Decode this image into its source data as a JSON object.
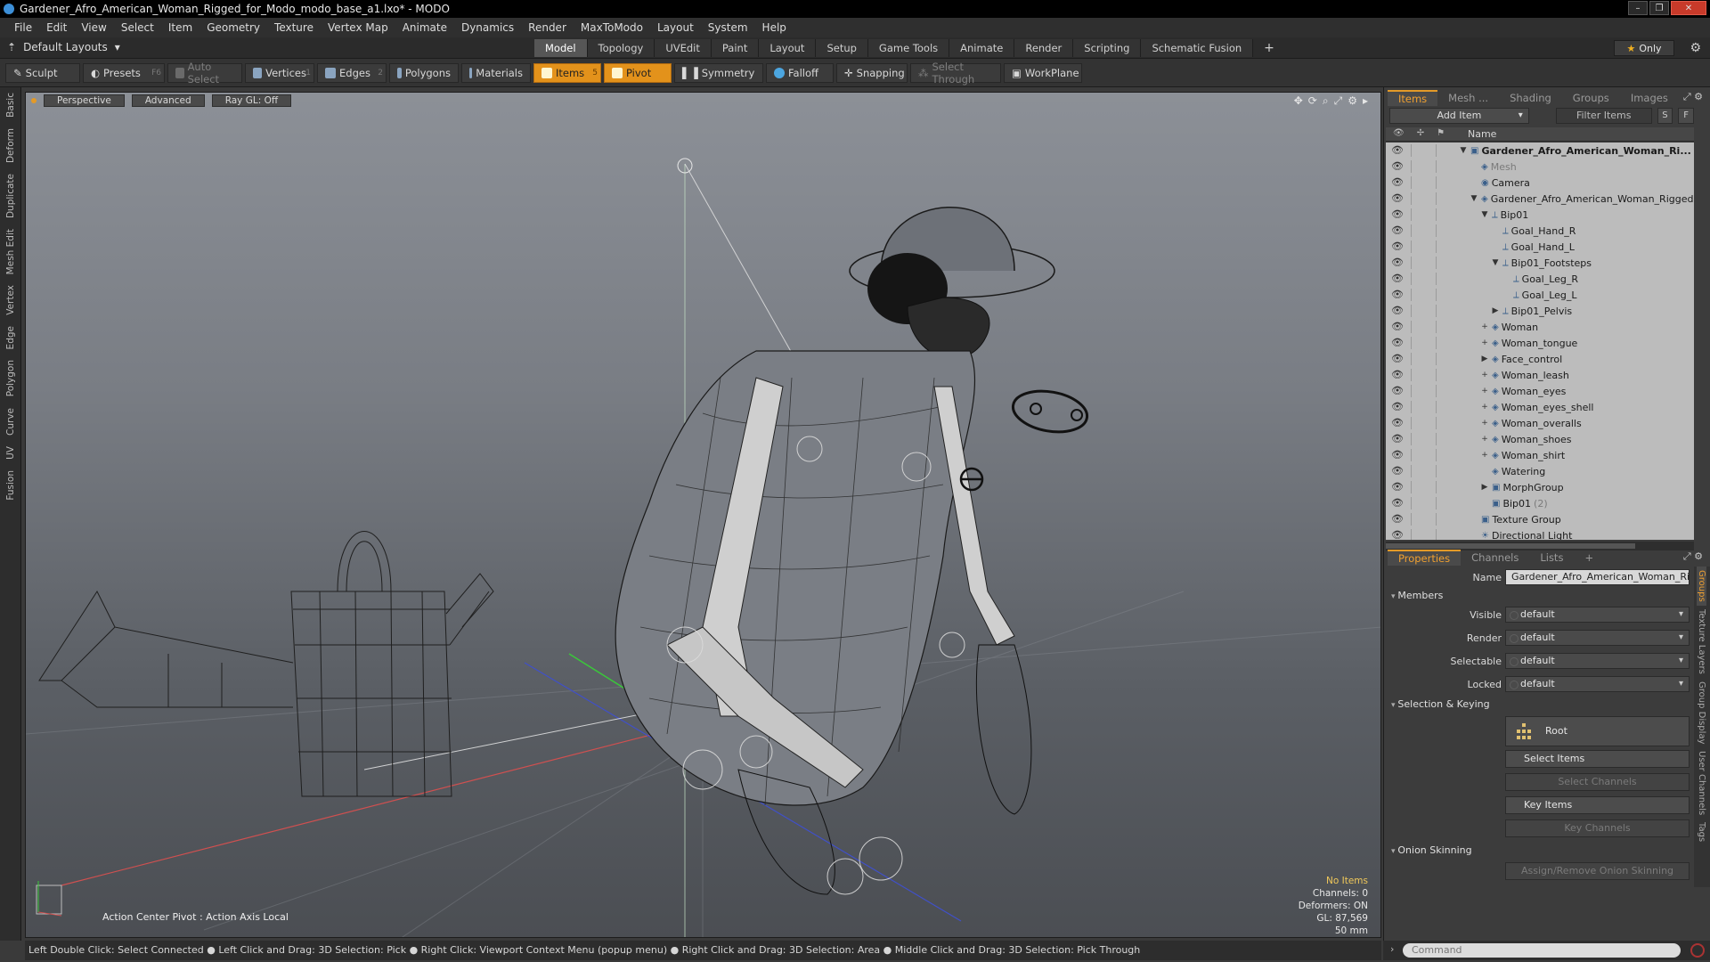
{
  "window": {
    "title": "Gardener_Afro_American_Woman_Rigged_for_Modo_modo_base_a1.lxo* - MODO",
    "minimize": "–",
    "maximize": "❐",
    "close": "✕"
  },
  "menu": [
    "File",
    "Edit",
    "View",
    "Select",
    "Item",
    "Geometry",
    "Texture",
    "Vertex Map",
    "Animate",
    "Dynamics",
    "Render",
    "MaxToModo",
    "Layout",
    "System",
    "Help"
  ],
  "layout": {
    "selector": "Default Layouts",
    "tabs": [
      "Model",
      "Topology",
      "UVEdit",
      "Paint",
      "Layout",
      "Setup",
      "Game Tools",
      "Animate",
      "Render",
      "Scripting",
      "Schematic Fusion"
    ],
    "active_tab": "Model",
    "add_tab": "+",
    "only_label": "Only"
  },
  "toolbar": {
    "sculpt": "Sculpt",
    "presets": "Presets",
    "presets_key": "F6",
    "auto_select": "Auto Select",
    "vertices": "Vertices",
    "vertices_key": "1",
    "edges": "Edges",
    "edges_key": "2",
    "polygons": "Polygons",
    "materials": "Materials",
    "items": "Items",
    "items_key": "5",
    "pivot": "Pivot",
    "symmetry": "Symmetry",
    "falloff": "Falloff",
    "snapping": "Snapping",
    "select_through": "Select Through",
    "workplane": "WorkPlane"
  },
  "left_tabs": [
    "Basic",
    "Deform",
    "Duplicate",
    "Mesh Edit",
    "Vertex",
    "Edge",
    "Polygon",
    "Curve",
    "UV",
    "Fusion"
  ],
  "viewport": {
    "view": "Perspective",
    "shading": "Advanced",
    "raygl": "Ray GL: Off",
    "action_center": "Action Center Pivot : Action Axis Local",
    "info": {
      "items": "No Items",
      "channels": "Channels: 0",
      "deformers": "Deformers: ON",
      "gl": "GL: 87,569",
      "focal": "50 mm"
    }
  },
  "items_panel": {
    "tabs": [
      "Items",
      "Mesh ...",
      "Shading",
      "Groups",
      "Images"
    ],
    "active_tab": "Items",
    "add_item": "Add Item",
    "filter": "Filter Items",
    "s_btn": "S",
    "f_btn": "F",
    "col_name": "Name",
    "rows": [
      {
        "label": "Gardener_Afro_American_Woman_Ri...",
        "indent": 0,
        "twisty": "▼",
        "icon": "group",
        "bold": true
      },
      {
        "label": "Mesh",
        "indent": 1,
        "twisty": "",
        "icon": "mesh",
        "dim": true
      },
      {
        "label": "Camera",
        "indent": 1,
        "twisty": "",
        "icon": "camera"
      },
      {
        "label": "Gardener_Afro_American_Woman_Rigged",
        "indent": 1,
        "twisty": "▼",
        "icon": "mesh"
      },
      {
        "label": "Bip01",
        "indent": 2,
        "twisty": "▼",
        "icon": "locator"
      },
      {
        "label": "Goal_Hand_R",
        "indent": 3,
        "twisty": "",
        "icon": "locator"
      },
      {
        "label": "Goal_Hand_L",
        "indent": 3,
        "twisty": "",
        "icon": "locator"
      },
      {
        "label": "Bip01_Footsteps",
        "indent": 3,
        "twisty": "▼",
        "icon": "locator"
      },
      {
        "label": "Goal_Leg_R",
        "indent": 4,
        "twisty": "",
        "icon": "locator"
      },
      {
        "label": "Goal_Leg_L",
        "indent": 4,
        "twisty": "",
        "icon": "locator"
      },
      {
        "label": "Bip01_Pelvis",
        "indent": 3,
        "twisty": "▶",
        "icon": "locator"
      },
      {
        "label": "Woman",
        "indent": 2,
        "twisty": "+",
        "icon": "mesh"
      },
      {
        "label": "Woman_tongue",
        "indent": 2,
        "twisty": "+",
        "icon": "mesh"
      },
      {
        "label": "Face_control",
        "indent": 2,
        "twisty": "▶",
        "icon": "mesh"
      },
      {
        "label": "Woman_leash",
        "indent": 2,
        "twisty": "+",
        "icon": "mesh"
      },
      {
        "label": "Woman_eyes",
        "indent": 2,
        "twisty": "+",
        "icon": "mesh"
      },
      {
        "label": "Woman_eyes_shell",
        "indent": 2,
        "twisty": "+",
        "icon": "mesh"
      },
      {
        "label": "Woman_overalls",
        "indent": 2,
        "twisty": "+",
        "icon": "mesh"
      },
      {
        "label": "Woman_shoes",
        "indent": 2,
        "twisty": "+",
        "icon": "mesh"
      },
      {
        "label": "Woman_shirt",
        "indent": 2,
        "twisty": "+",
        "icon": "mesh"
      },
      {
        "label": "Watering",
        "indent": 2,
        "twisty": "",
        "icon": "mesh"
      },
      {
        "label": "MorphGroup",
        "indent": 2,
        "twisty": "▶",
        "icon": "group"
      },
      {
        "label": "Bip01",
        "indent": 2,
        "twisty": "",
        "icon": "group",
        "count": "(2)"
      },
      {
        "label": "Texture Group",
        "indent": 1,
        "twisty": "",
        "icon": "group"
      },
      {
        "label": "Directional Light",
        "indent": 1,
        "twisty": "",
        "icon": "light"
      }
    ]
  },
  "properties": {
    "tabs": [
      "Properties",
      "Channels",
      "Lists"
    ],
    "active_tab": "Properties",
    "add_tab": "+",
    "name_label": "Name",
    "name_value": "Gardener_Afro_American_Woman_Rigged",
    "members_section": "Members",
    "fields": [
      {
        "label": "Visible",
        "value": "default"
      },
      {
        "label": "Render",
        "value": "default"
      },
      {
        "label": "Selectable",
        "value": "default"
      },
      {
        "label": "Locked",
        "value": "default"
      }
    ],
    "selection_section": "Selection & Keying",
    "root_label": "Root",
    "select_items": "Select Items",
    "select_channels": "Select Channels",
    "key_items": "Key Items",
    "key_channels": "Key Channels",
    "onion_section": "Onion Skinning",
    "onion_button": "Assign/Remove Onion Skinning",
    "side_tabs": [
      "Groups",
      "Texture Layers",
      "Group Display",
      "User Channels",
      "Tags"
    ]
  },
  "status_bar": "Left Double Click: Select Connected ● Left Click and Drag: 3D Selection: Pick ● Right Click: Viewport Context Menu (popup menu) ● Right Click and Drag: 3D Selection: Area ● Middle Click and Drag: 3D Selection: Pick Through",
  "command": {
    "chevron": "›",
    "placeholder": "Command"
  },
  "colors": {
    "accent": "#e39a28",
    "title_bar": "#000000",
    "panel": "#3c3c3c",
    "tree_bg": "#bcbcbc"
  }
}
